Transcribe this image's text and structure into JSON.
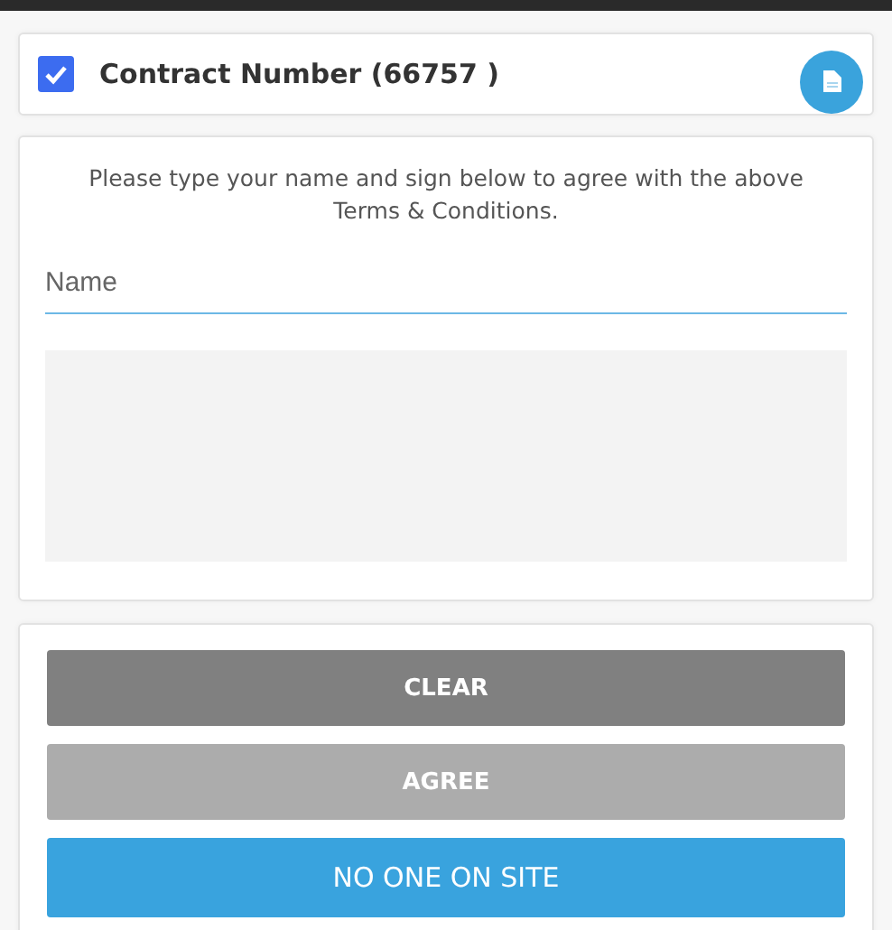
{
  "contract": {
    "label": "Contract Number (66757 )",
    "checked": true
  },
  "agreement": {
    "instruction": "Please type your name and sign below to agree with the above Terms & Conditions.",
    "name_field": {
      "placeholder": "Name"
    }
  },
  "buttons": [
    {
      "label": "CLEAR",
      "kind": "secondary",
      "disabled": false
    },
    {
      "label": "AGREE",
      "kind": "secondary",
      "disabled": true
    },
    {
      "label": "NO ONE ON SITE",
      "kind": "primary",
      "disabled": false
    }
  ]
}
